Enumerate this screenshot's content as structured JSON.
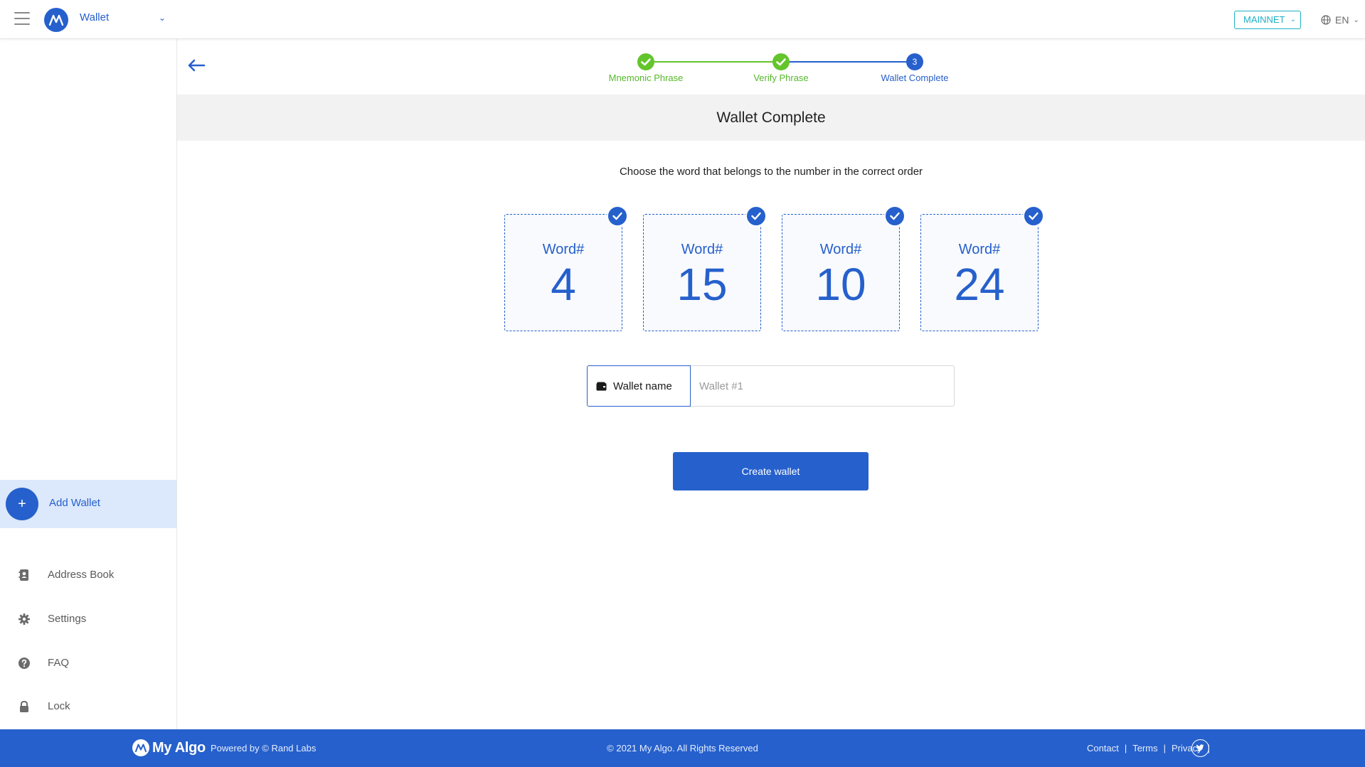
{
  "header": {
    "wallet_select": "Wallet",
    "network": "MAINNET",
    "language": "EN"
  },
  "sidebar": {
    "add_wallet": "Add Wallet",
    "items": [
      {
        "label": "Address Book",
        "icon": "address-book-icon"
      },
      {
        "label": "Settings",
        "icon": "gear-icon"
      },
      {
        "label": "FAQ",
        "icon": "question-circle-icon"
      },
      {
        "label": "Lock",
        "icon": "lock-icon"
      }
    ]
  },
  "stepper": {
    "steps": [
      {
        "label": "Mnemonic Phrase",
        "state": "done"
      },
      {
        "label": "Verify Phrase",
        "state": "done"
      },
      {
        "label": "Wallet Complete",
        "state": "current",
        "number": "3"
      }
    ]
  },
  "main": {
    "title": "Wallet Complete",
    "instruction": "Choose the word that belongs to the number in the correct order",
    "words": [
      {
        "label": "Word#",
        "number": "4"
      },
      {
        "label": "Word#",
        "number": "15"
      },
      {
        "label": "Word#",
        "number": "10"
      },
      {
        "label": "Word#",
        "number": "24"
      }
    ],
    "wallet_name_label": "Wallet name",
    "wallet_name_placeholder": "Wallet #1",
    "create_button": "Create wallet"
  },
  "footer": {
    "brand": "My Algo",
    "powered_by": "Powered by  © Rand Labs",
    "copyright": "© 2021 My Algo.  All Rights Reserved",
    "links": [
      "Contact",
      "Terms",
      "Privacy"
    ]
  },
  "colors": {
    "primary": "#2660cc",
    "success": "#64c42c",
    "network_accent": "#1fb0c8",
    "active_bg": "#dce8fb"
  }
}
